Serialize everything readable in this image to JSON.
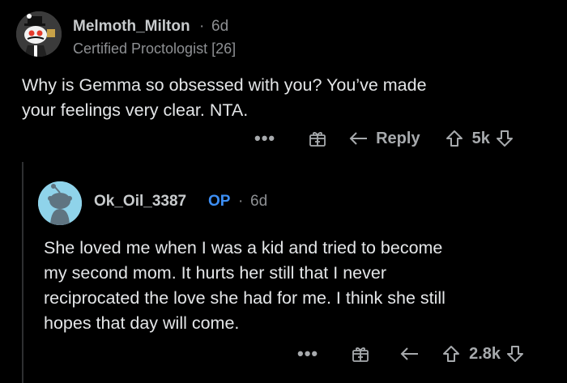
{
  "comment1": {
    "username": "Melmoth_Milton",
    "age": "6d",
    "flair": "Certified Proctologist [26]",
    "body_line1": "Why is Gemma so obsessed with you? You’ve made",
    "body_line2": "your feelings very clear. NTA.",
    "reply_label": "Reply",
    "votes": "5k",
    "more": "•••"
  },
  "comment2": {
    "username": "Ok_Oil_3387",
    "op_badge": "OP",
    "age": "6d",
    "body_line1": "She loved me when I was a kid and tried to become",
    "body_line2": "my second mom. It hurts her still that I never",
    "body_line3": "reciprocated the love she had for me. I think she still",
    "body_line4": "hopes that day will come.",
    "votes": "2.8k",
    "more": "•••"
  },
  "separator": "·",
  "colors": {
    "background": "#000000",
    "op": "#3d8ff5",
    "text": "#e4e6e8",
    "muted": "#8e9093"
  }
}
